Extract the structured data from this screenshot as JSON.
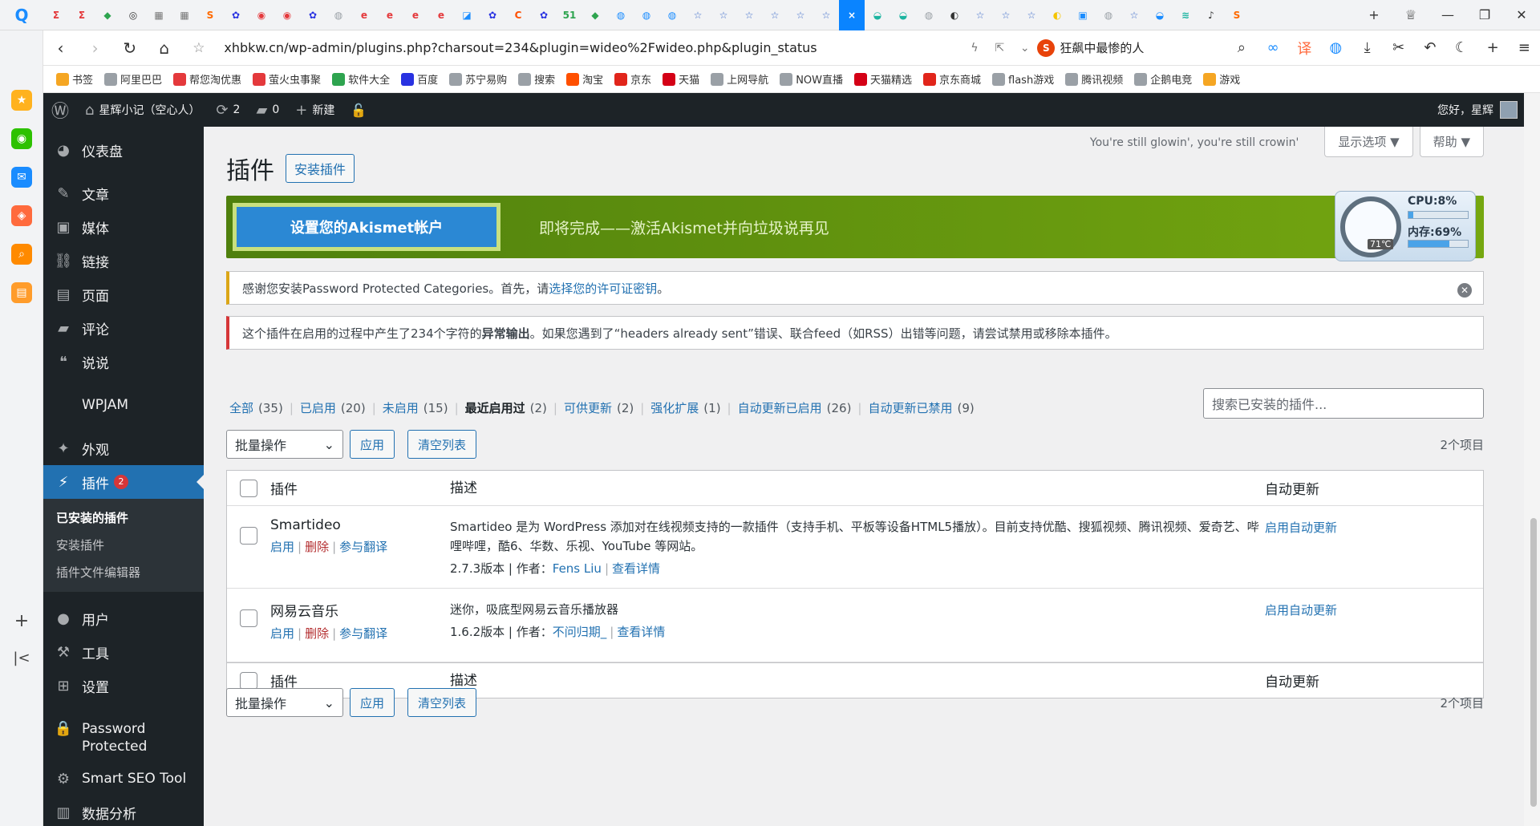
{
  "browser": {
    "url": "xhbkw.cn/wp-admin/plugins.php?charsout=234&plugin=wideo%2Fwideo.php&plugin_status",
    "search_text": "狂飙中最惨的人",
    "tab_favicons": [
      "Σ",
      "Σ",
      "◆",
      "◎",
      "▦",
      "▦",
      "S",
      "✿",
      "◉",
      "◉",
      "✿",
      "◍",
      "e",
      "e",
      "e",
      "e",
      "◪",
      "✿",
      "C",
      "✿",
      "51",
      "◆",
      "◍",
      "◍",
      "◍",
      "☆",
      "☆",
      "☆",
      "☆",
      "☆",
      "☆",
      "×",
      "◒",
      "◒",
      "◍",
      "◐",
      "☆",
      "☆",
      "☆",
      "◐",
      "▣",
      "◍",
      "☆",
      "◒",
      "≋",
      "♪",
      "S"
    ],
    "bookmarks": [
      {
        "label": "书签",
        "color": "#f5a623"
      },
      {
        "label": "阿里巴巴",
        "color": "#9aa0a6"
      },
      {
        "label": "帮您淘优惠",
        "color": "#e4393c"
      },
      {
        "label": "萤火虫事聚",
        "color": "#e4393c"
      },
      {
        "label": "软件大全",
        "color": "#2ea44f"
      },
      {
        "label": "百度",
        "color": "#2932e1"
      },
      {
        "label": "苏宁易购",
        "color": "#9aa0a6"
      },
      {
        "label": "搜索",
        "color": "#9aa0a6"
      },
      {
        "label": "淘宝",
        "color": "#ff5000"
      },
      {
        "label": "京东",
        "color": "#e1251b"
      },
      {
        "label": "天猫",
        "color": "#d40016"
      },
      {
        "label": "上网导航",
        "color": "#9aa0a6"
      },
      {
        "label": "NOW直播",
        "color": "#9aa0a6"
      },
      {
        "label": "天猫精选",
        "color": "#d40016"
      },
      {
        "label": "京东商城",
        "color": "#e1251b"
      },
      {
        "label": "flash游戏",
        "color": "#9aa0a6"
      },
      {
        "label": "腾讯视频",
        "color": "#9aa0a6"
      },
      {
        "label": "企鹅电竞",
        "color": "#9aa0a6"
      },
      {
        "label": "游戏",
        "color": "#f5a623"
      }
    ]
  },
  "adminbar": {
    "site_name": "星辉小记（空心人）",
    "updates_count": "2",
    "comments_count": "0",
    "new_label": "新建",
    "greeting": "您好，星辉"
  },
  "sidebar": {
    "items": [
      {
        "label": "仪表盘",
        "icon": "dashboard-icon",
        "glyph": "◕"
      },
      {
        "label": "文章",
        "icon": "pin-icon",
        "glyph": "✎"
      },
      {
        "label": "媒体",
        "icon": "media-icon",
        "glyph": "▣"
      },
      {
        "label": "链接",
        "icon": "link-icon",
        "glyph": "⛓"
      },
      {
        "label": "页面",
        "icon": "page-icon",
        "glyph": "▤"
      },
      {
        "label": "评论",
        "icon": "comment-icon",
        "glyph": "▰"
      },
      {
        "label": "说说",
        "icon": "quote-icon",
        "glyph": "❝"
      },
      {
        "label": "WPJAM",
        "icon": "",
        "glyph": ""
      },
      {
        "label": "外观",
        "icon": "appearance-icon",
        "glyph": "✦"
      },
      {
        "label": "插件",
        "icon": "plugin-icon",
        "glyph": "⚡",
        "badge": "2"
      },
      {
        "label": "用户",
        "icon": "user-icon",
        "glyph": "●"
      },
      {
        "label": "工具",
        "icon": "tools-icon",
        "glyph": "⚒"
      },
      {
        "label": "设置",
        "icon": "settings-icon",
        "glyph": "⊞"
      },
      {
        "label": "Password Protected",
        "icon": "lock-icon",
        "glyph": "🔒"
      },
      {
        "label": "Smart SEO Tool",
        "icon": "seo-icon",
        "glyph": "⚙"
      },
      {
        "label": "数据分析",
        "icon": "analytics-icon",
        "glyph": "▥"
      }
    ],
    "submenu": [
      "已安装的插件",
      "安装插件",
      "插件文件编辑器"
    ]
  },
  "page": {
    "title": "插件",
    "add_new": "安装插件",
    "quote": "You're still glowin', you're still crowin'",
    "screen_options": "显示选项",
    "help": "帮助"
  },
  "akismet": {
    "button": "设置您的Akismet帐户",
    "text": "即将完成——激活Akismet并向垃圾说再见"
  },
  "sysmon": {
    "cpu": "CPU:8%",
    "cpu_value": 8,
    "mem": "内存:69%",
    "mem_value": 69,
    "temp": "71℃"
  },
  "notices": {
    "license_pre": "感谢您安装Password Protected Categories。首先，请",
    "license_link": "选择您的许可证密钥",
    "license_post": "。",
    "error_pre": "这个插件在启用的过程中产生了234个字符的",
    "error_strong": "异常输出",
    "error_post": "。如果您遇到了“headers already sent”错误、联合feed（如RSS）出错等问题，请尝试禁用或移除本插件。"
  },
  "filters": [
    {
      "label": "全部",
      "count": "(35)"
    },
    {
      "label": "已启用",
      "count": "(20)"
    },
    {
      "label": "未启用",
      "count": "(15)"
    },
    {
      "label": "最近启用过",
      "count": "(2)",
      "current": true
    },
    {
      "label": "可供更新",
      "count": "(2)"
    },
    {
      "label": "强化扩展",
      "count": "(1)"
    },
    {
      "label": "自动更新已启用",
      "count": "(26)"
    },
    {
      "label": "自动更新已禁用",
      "count": "(9)"
    }
  ],
  "search_placeholder": "搜索已安装的插件...",
  "tablenav": {
    "bulk": "批量操作",
    "apply": "应用",
    "clear": "清空列表",
    "count": "2个项目"
  },
  "table": {
    "col_plugin": "插件",
    "col_desc": "描述",
    "col_auto": "自动更新",
    "rows": [
      {
        "name": "Smartideo",
        "actions": [
          "启用",
          "删除",
          "参与翻译"
        ],
        "description": "Smartideo 是为 WordPress 添加对在线视频支持的一款插件（支持手机、平板等设备HTML5播放）。目前支持优酷、搜狐视频、腾讯视频、爱奇艺、哔哩哔哩，酷6、华数、乐视、YouTube 等网站。",
        "version": "2.7.3版本 | 作者：",
        "author": "Fens Liu",
        "details": "查看详情",
        "auto": "启用自动更新"
      },
      {
        "name": "网易云音乐",
        "actions": [
          "启用",
          "删除",
          "参与翻译"
        ],
        "description": "迷你，吸底型网易云音乐播放器",
        "version": "1.6.2版本 | 作者：",
        "author": "不问归期_",
        "details": "查看详情",
        "auto": "启用自动更新"
      }
    ]
  }
}
